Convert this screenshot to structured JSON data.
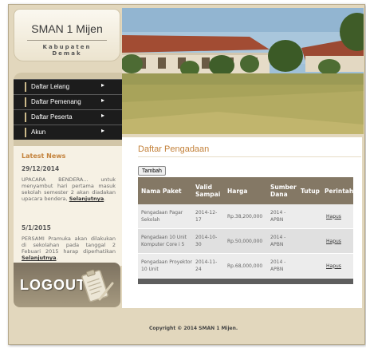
{
  "brand": {
    "school": "SMAN 1 Mijen",
    "region": "Kabupaten Demak"
  },
  "nav": [
    {
      "label": "Daftar Lelang"
    },
    {
      "label": "Daftar Pemenang"
    },
    {
      "label": "Daftar Peserta"
    },
    {
      "label": "Akun"
    }
  ],
  "news": {
    "title": "Latest News",
    "items": [
      {
        "date": "29/12/2014",
        "text": "UPACARA BENDERA... untuk menyambut hari pertama masuk sekolah semester 2 akan diadakan upacara bendera,",
        "link": "Selanjutnya"
      },
      {
        "date": "5/1/2015",
        "text": "PERSAMI Pramuka akan dilakukan di sekolahan pada tanggal 2 Febuari 2015 harap diperhatikan",
        "link": "Selanjutnya"
      }
    ]
  },
  "logout_label": "LOGOUT",
  "page": {
    "title": "Daftar Pengadaan",
    "add_label": "Tambah",
    "headers": {
      "nama": "Nama Paket",
      "valid": "Valid Sampai",
      "harga": "Harga",
      "sumber": "Sumber Dana",
      "tutup": "Tutup",
      "perintah": "Perintah"
    },
    "rows": [
      {
        "nama": "Pengadaan Pagar Sekolah",
        "valid": "2014-12-17",
        "harga": "Rp.38,200,000",
        "sumber": "2014 - APBN",
        "tutup": "",
        "action": "Hapus"
      },
      {
        "nama": "Pengadaan 10 Unit Komputer Core i 5",
        "valid": "2014-10-30",
        "harga": "Rp.50,000,000",
        "sumber": "2014 - APBN",
        "tutup": "",
        "action": "Hapus"
      },
      {
        "nama": "Pengadaan Proyektor 10 Unit",
        "valid": "2014-11-24",
        "harga": "Rp.68,000,000",
        "sumber": "2014 - APBN",
        "tutup": "",
        "action": "Hapus"
      }
    ]
  },
  "footer": "Copyright © 2014 SMAN 1 Mijen."
}
